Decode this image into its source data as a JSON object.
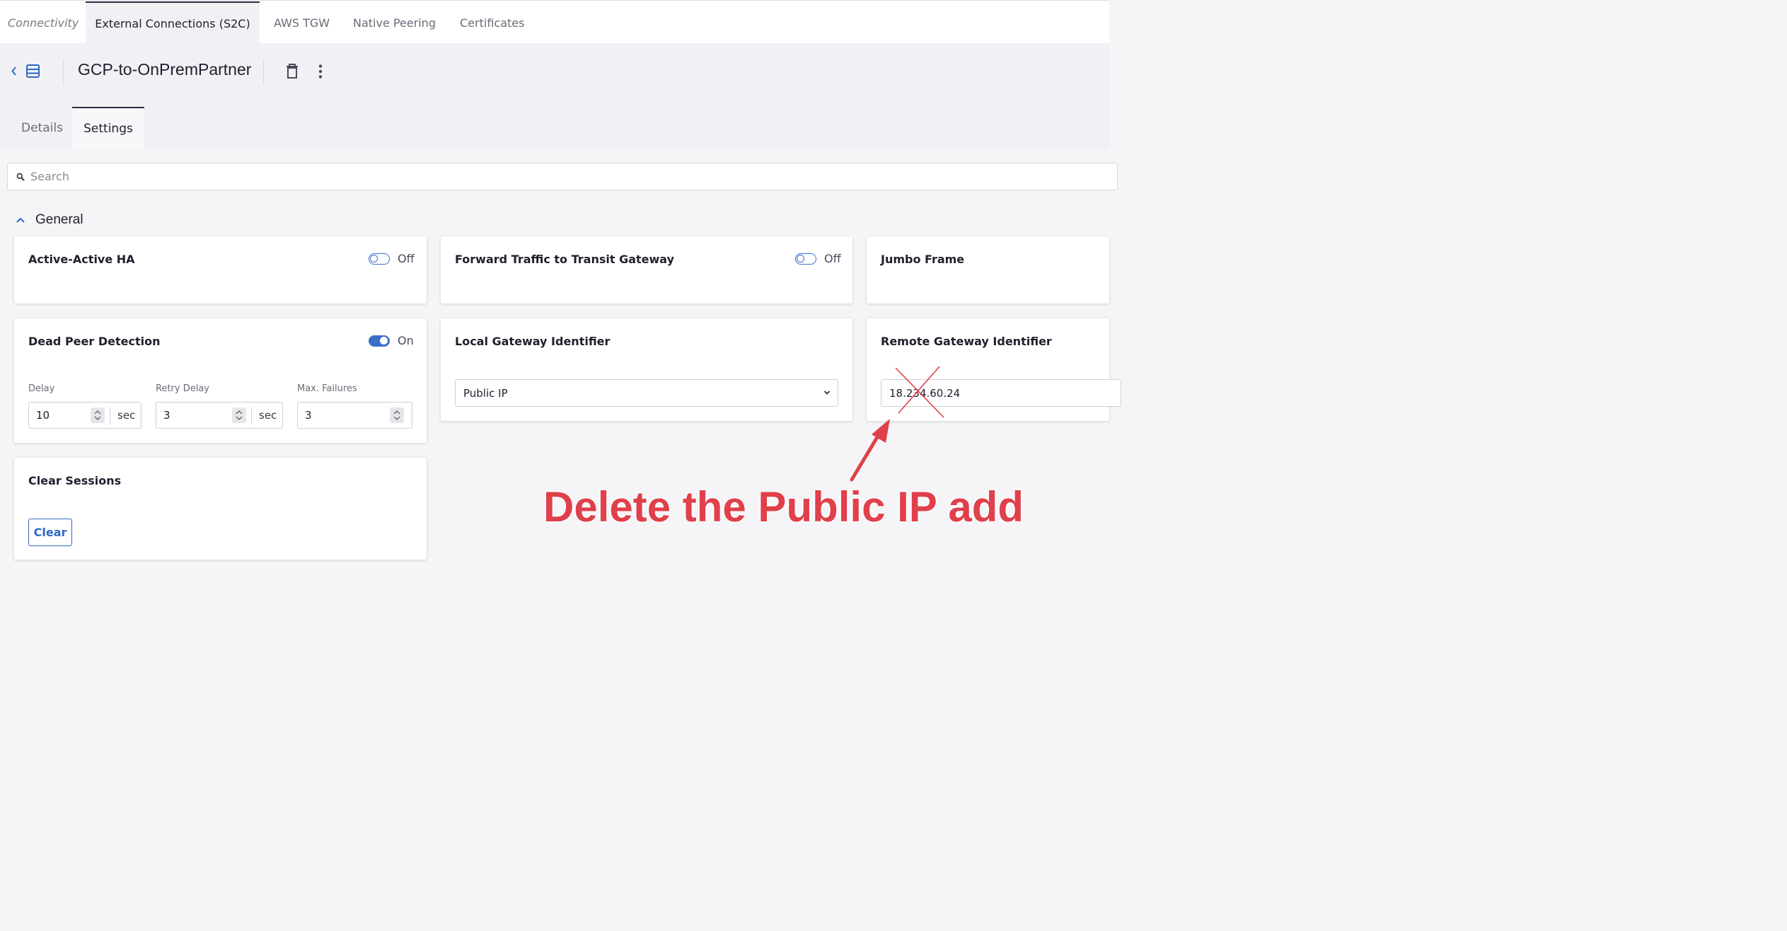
{
  "top_tabs": {
    "connectivity": "Connectivity",
    "external": "External Connections (S2C)",
    "aws_tgw": "AWS TGW",
    "native_peering": "Native Peering",
    "certificates": "Certificates"
  },
  "header": {
    "title": "GCP-to-OnPremPartner",
    "icons": [
      "chevron-left-icon",
      "list-view-icon",
      "trash-icon",
      "more-vertical-icon"
    ]
  },
  "sub_tabs": {
    "details": "Details",
    "settings": "Settings"
  },
  "search": {
    "placeholder": "Search"
  },
  "section": {
    "title": "General"
  },
  "cards": {
    "active_active_ha": {
      "title": "Active-Active HA",
      "toggle_state": "Off"
    },
    "forward_traffic": {
      "title": "Forward Traffic to Transit Gateway",
      "toggle_state": "Off"
    },
    "jumbo_frame": {
      "title": "Jumbo Frame"
    },
    "dead_peer": {
      "title": "Dead Peer Detection",
      "toggle_state": "On",
      "delay_label": "Delay",
      "delay_value": "10",
      "delay_unit": "sec",
      "retry_label": "Retry Delay",
      "retry_value": "3",
      "retry_unit": "sec",
      "max_label": "Max. Failures",
      "max_value": "3"
    },
    "local_gateway": {
      "title": "Local Gateway Identifier",
      "selected": "Public IP"
    },
    "remote_gateway": {
      "title": "Remote Gateway Identifier",
      "value": "18.234.60.24"
    },
    "clear_sessions": {
      "title": "Clear Sessions",
      "button": "Clear"
    }
  },
  "annotation": {
    "text": "Delete the Public IP add",
    "color": "#e0404a"
  },
  "colors": {
    "accent": "#3a6fc8",
    "annotation": "#e0404a"
  }
}
